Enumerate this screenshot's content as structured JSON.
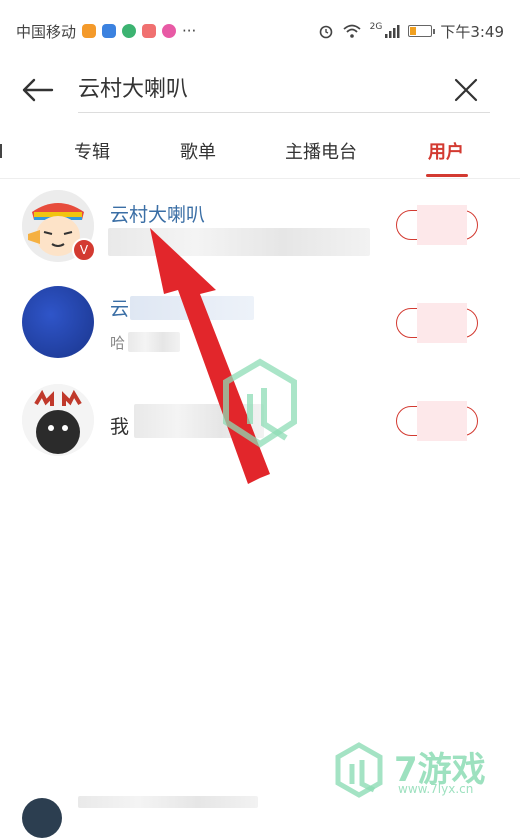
{
  "status_bar": {
    "carrier": "中国移动",
    "more": "···",
    "time": "下午3:49",
    "network": "2G"
  },
  "search": {
    "query": "云村大喇叭"
  },
  "tabs": [
    {
      "label": "专辑"
    },
    {
      "label": "歌单"
    },
    {
      "label": "主播电台"
    },
    {
      "label": "用户",
      "active": true
    }
  ],
  "users": [
    {
      "name": "云村大喇叭",
      "verified": true,
      "badge": "V"
    },
    {
      "name": "云",
      "subtitle": "哈"
    },
    {
      "name": "我"
    }
  ],
  "watermark": {
    "brand": "7游戏",
    "url": "www.7lyx.cn"
  },
  "colors": {
    "accent": "#d33a31",
    "link": "#3a6ea5"
  }
}
